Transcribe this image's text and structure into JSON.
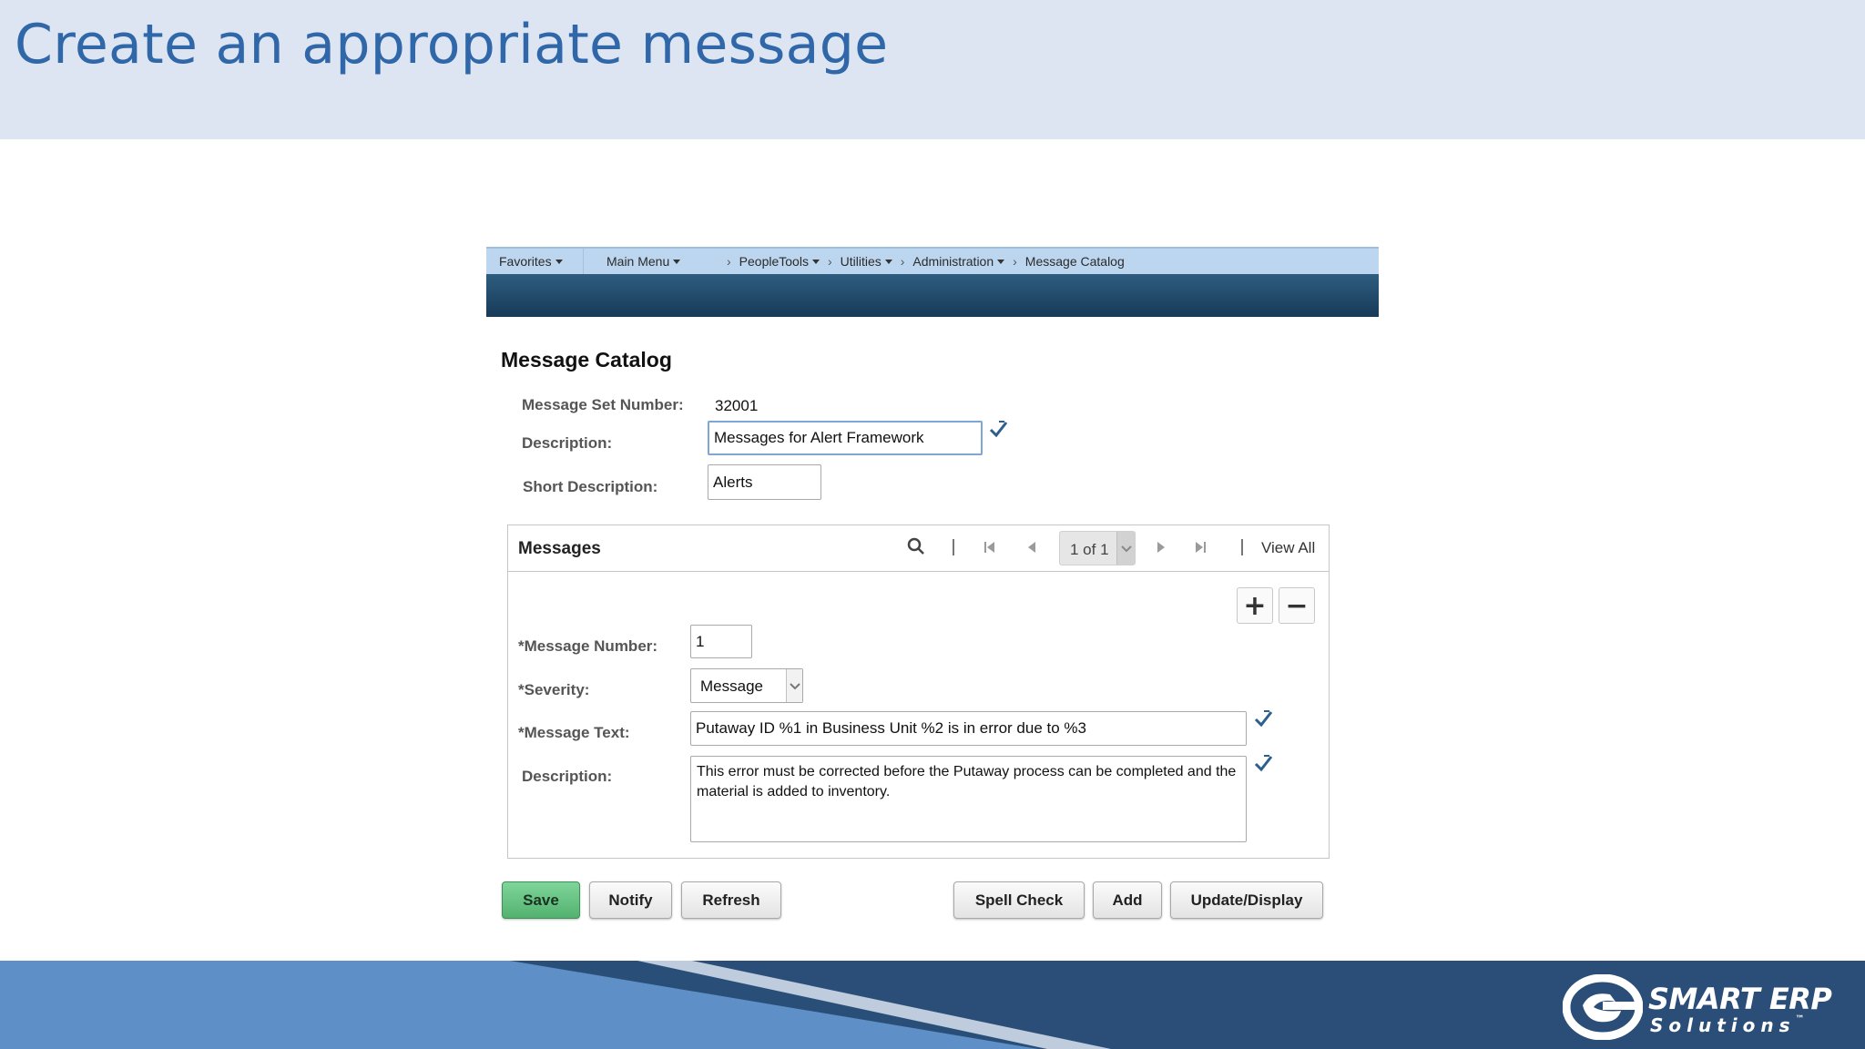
{
  "slide": {
    "title": "Create an appropriate message"
  },
  "nav": {
    "favorites": "Favorites",
    "main_menu": "Main Menu",
    "peopletools": "PeopleTools",
    "utilities": "Utilities",
    "administration": "Administration",
    "message_catalog": "Message Catalog",
    "separator": "›"
  },
  "page": {
    "title": "Message Catalog",
    "message_set_number_label": "Message Set Number:",
    "message_set_number": "32001",
    "description_label": "Description:",
    "description": "Messages for Alert Framework",
    "short_description_label": "Short Description:",
    "short_description": "Alerts"
  },
  "messages_grid": {
    "title": "Messages",
    "pager": "1 of 1",
    "view_all": "View All",
    "add_row": "+",
    "delete_row": "−",
    "message_number_label": "*Message Number:",
    "message_number": "1",
    "severity_label": "*Severity:",
    "severity": "Message",
    "message_text_label": "*Message Text:",
    "message_text": "Putaway ID %1 in Business Unit %2 is in error due to %3",
    "description_label": "Description:",
    "description": "This error must be corrected before the Putaway process can be completed and the material is added to inventory."
  },
  "toolbar": {
    "save": "Save",
    "notify": "Notify",
    "refresh": "Refresh",
    "spell_check": "Spell Check",
    "add": "Add",
    "update_display": "Update/Display"
  },
  "logo": {
    "line1": "SMART ERP",
    "line2": "Solutions",
    "trademark": "™"
  },
  "colors": {
    "header_bg": "#dde5f3",
    "title": "#2f67a8",
    "nav_bg": "#bcd6ef",
    "band": "#1f4a6c",
    "save_button": "#5bbd78",
    "footer": "#5e8fc6"
  }
}
